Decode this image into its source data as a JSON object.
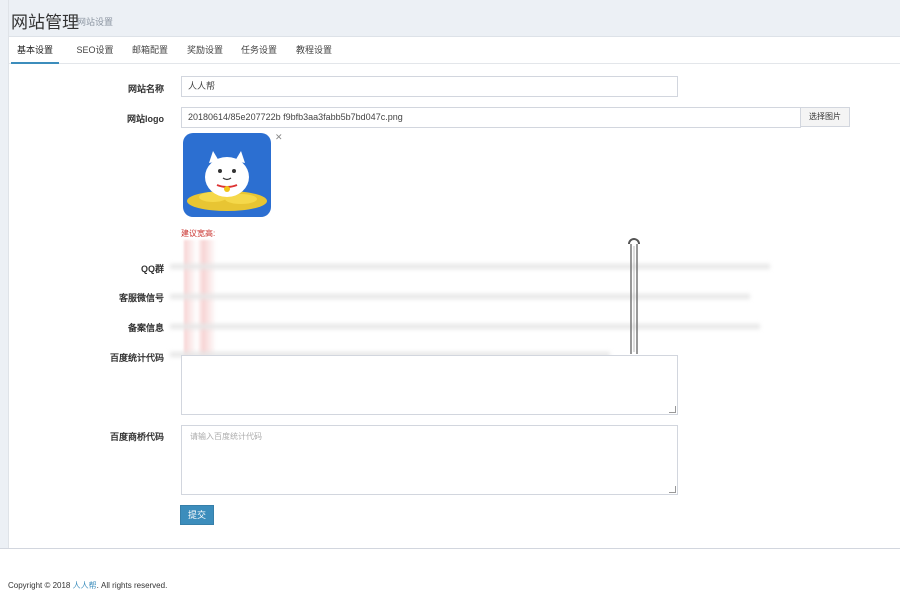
{
  "header": {
    "title": "网站管理",
    "subtitle": "网站设置"
  },
  "tabs": [
    {
      "label": "基本设置",
      "active": true
    },
    {
      "label": "SEO设置",
      "active": false
    },
    {
      "label": "邮箱配置",
      "active": false
    },
    {
      "label": "奖励设置",
      "active": false
    },
    {
      "label": "任务设置",
      "active": false
    },
    {
      "label": "教程设置",
      "active": false
    }
  ],
  "form": {
    "site_name": {
      "label": "网站名称",
      "value": "人人帮"
    },
    "site_logo": {
      "label": "网站logo",
      "value": "20180614/85e207722b f9bfb3aa3fabb5b7bd047c.png",
      "button": "选择图片",
      "hint": "建议宽高:"
    },
    "qq": {
      "label": "QQ群"
    },
    "service_wechat": {
      "label": "客服微信号"
    },
    "icp": {
      "label": "备案信息"
    },
    "baidu_stats": {
      "label": "百度统计代码"
    },
    "baidu_bridge": {
      "label": "百度商桥代码",
      "placeholder": "请输入百度统计代码"
    },
    "submit": "提交"
  },
  "footer": {
    "prefix": "Copyright © 2018",
    "link": "人人帮",
    "suffix": ". All rights reserved."
  },
  "colors": {
    "accent": "#3c8dbc",
    "background": "#ecf0f5",
    "hint_red": "#c9302c",
    "logo_blue": "#2c6fd1"
  }
}
